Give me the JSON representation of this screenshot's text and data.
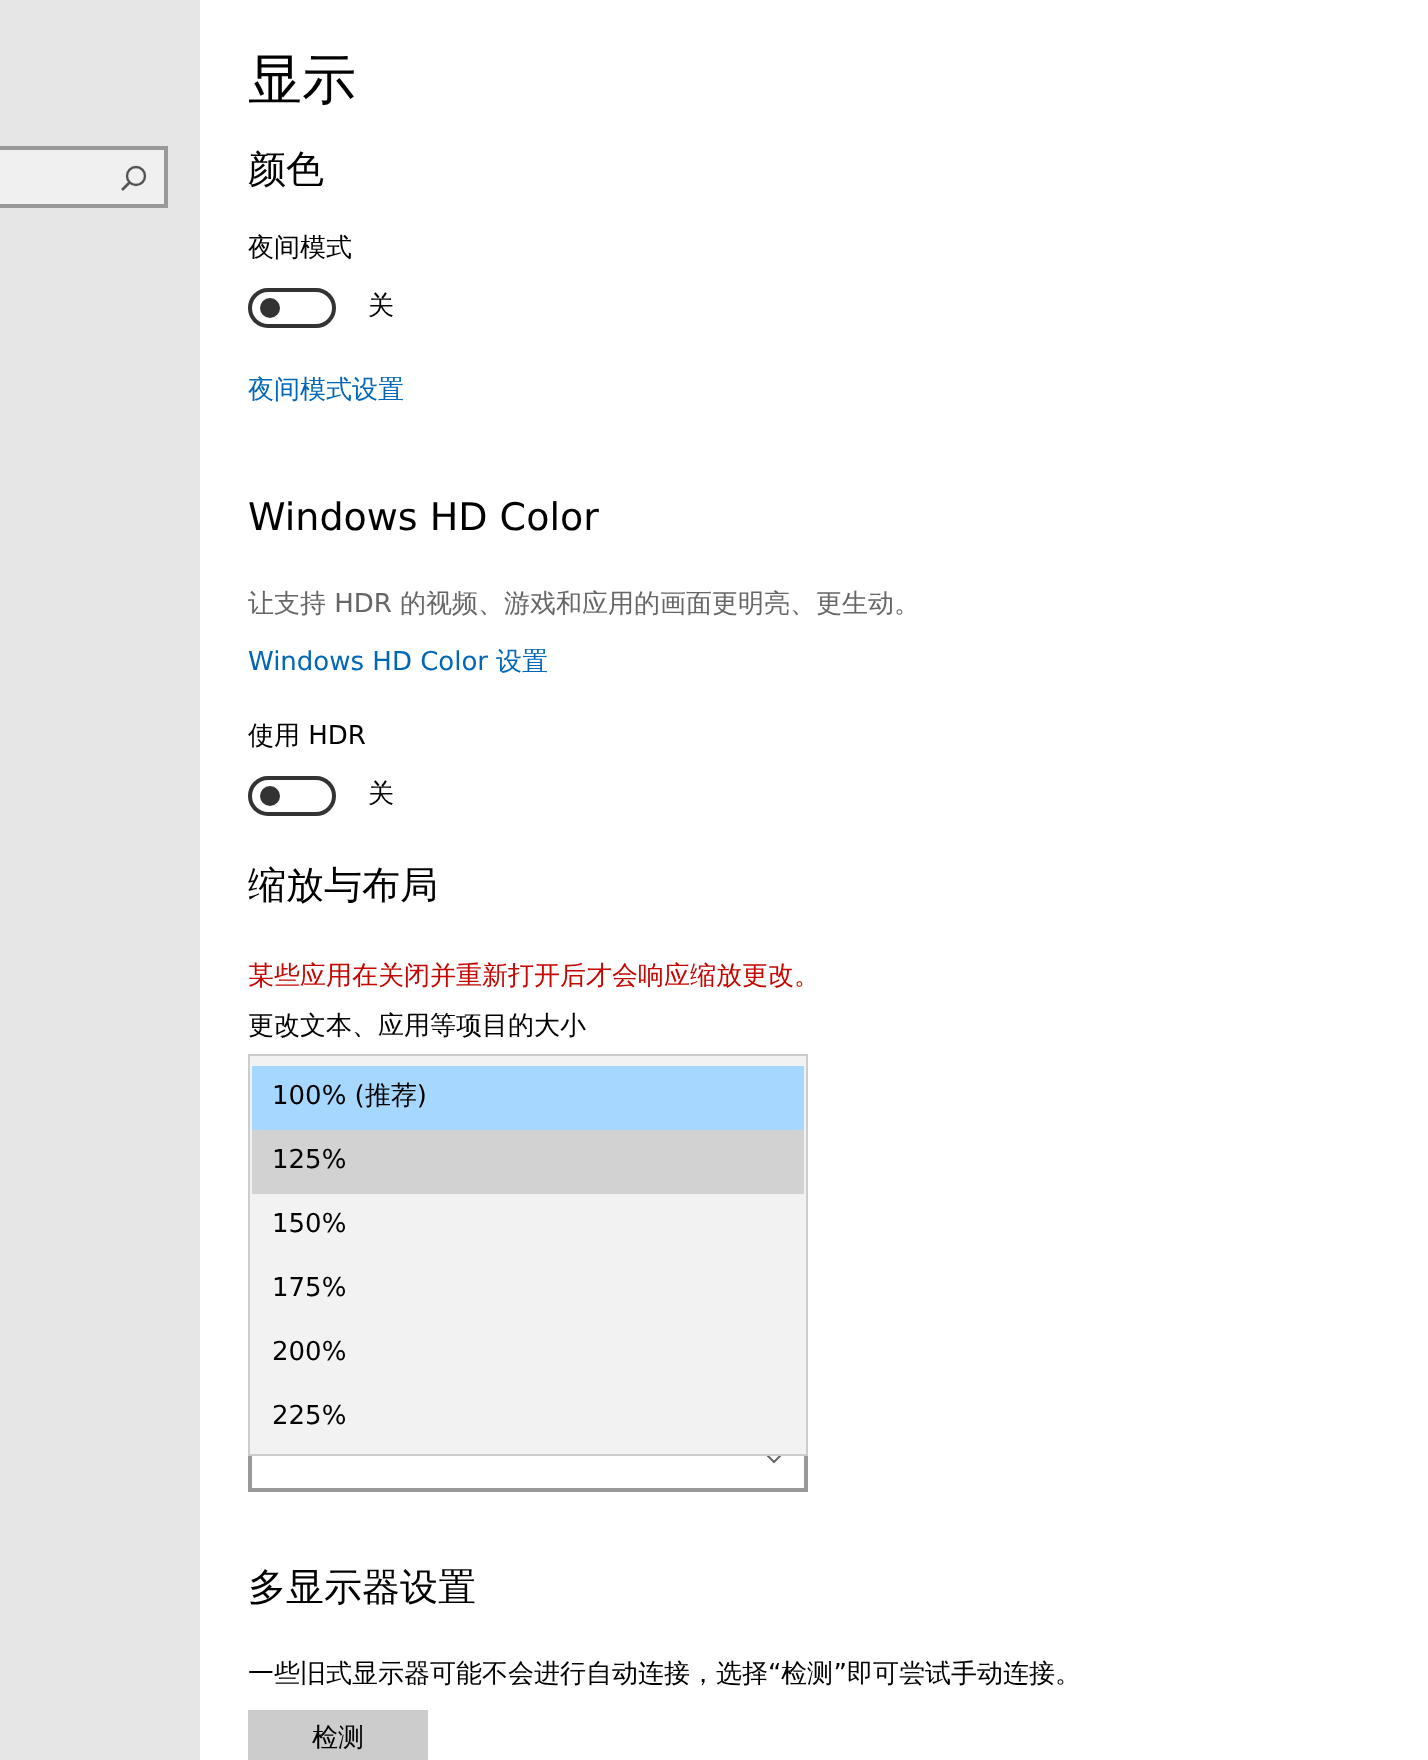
{
  "page_title": "显示",
  "sections": [
    {
      "heading": "颜色",
      "items": [
        {
          "kind": "toggle",
          "label": "夜间模式",
          "on": false,
          "state_text": "关"
        },
        {
          "kind": "link",
          "text": "夜间模式设置"
        }
      ]
    },
    {
      "heading": "Windows HD Color",
      "items": [
        {
          "kind": "description",
          "text": "让支持 HDR 的视频、游戏和应用的画面更明亮、更生动。"
        },
        {
          "kind": "link",
          "text": "Windows HD Color 设置"
        },
        {
          "kind": "toggle",
          "label": "使用 HDR",
          "on": false,
          "state_text": "关"
        }
      ]
    },
    {
      "heading": "缩放与布局",
      "items": [
        {
          "kind": "warning",
          "text": "某些应用在关闭并重新打开后才会响应缩放更改。"
        },
        {
          "kind": "dropdown",
          "label": "更改文本、应用等项目的大小",
          "options": [
            {
              "text": "100% (推荐)",
              "selected": true,
              "hovered": false
            },
            {
              "text": "125%",
              "selected": false,
              "hovered": true
            },
            {
              "text": "150%",
              "selected": false,
              "hovered": false
            },
            {
              "text": "175%",
              "selected": false,
              "hovered": false
            },
            {
              "text": "200%",
              "selected": false,
              "hovered": false
            },
            {
              "text": "225%",
              "selected": false,
              "hovered": false
            }
          ]
        }
      ]
    },
    {
      "heading": "多显示器设置",
      "items": [
        {
          "kind": "text",
          "text": "一些旧式显示器可能不会进行自动连接，选择“检测”即可尝试手动连接。"
        },
        {
          "kind": "button",
          "text": "检测"
        }
      ]
    }
  ]
}
